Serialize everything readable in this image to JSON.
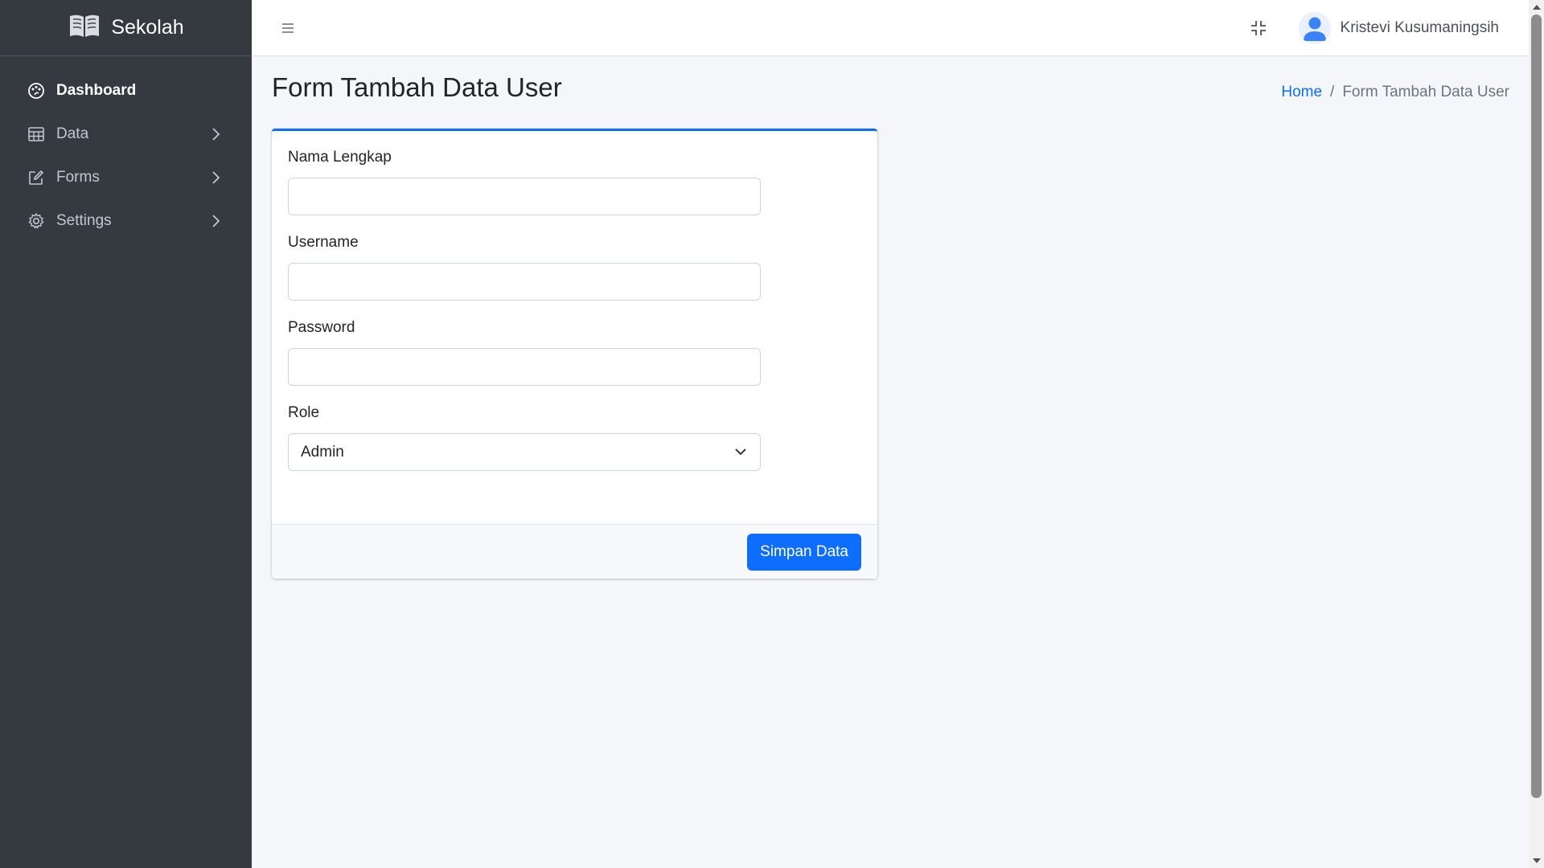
{
  "brand": {
    "name": "Sekolah",
    "icon": "book-open-icon"
  },
  "sidebar": {
    "items": [
      {
        "label": "Dashboard",
        "icon": "palette-icon",
        "active": true,
        "has_submenu": false
      },
      {
        "label": "Data",
        "icon": "table-icon",
        "active": false,
        "has_submenu": true
      },
      {
        "label": "Forms",
        "icon": "pencil-square-icon",
        "active": false,
        "has_submenu": true
      },
      {
        "label": "Settings",
        "icon": "gear-icon",
        "active": false,
        "has_submenu": true
      }
    ]
  },
  "topbar": {
    "menu_icon": "hamburger-icon",
    "fullscreen_icon": "fullscreen-exit-icon",
    "user": {
      "name": "Kristevi Kusumaningsih",
      "avatar_icon": "user-avatar-icon"
    }
  },
  "page": {
    "title": "Form Tambah Data User",
    "breadcrumb": {
      "home": "Home",
      "separator": "/",
      "current": "Form Tambah Data User"
    }
  },
  "form": {
    "fields": {
      "nama_lengkap": {
        "label": "Nama Lengkap",
        "value": "",
        "placeholder": ""
      },
      "username": {
        "label": "Username",
        "value": "",
        "placeholder": ""
      },
      "password": {
        "label": "Password",
        "value": "",
        "placeholder": ""
      },
      "role": {
        "label": "Role",
        "selected": "Admin"
      }
    },
    "submit_label": "Simpan Data"
  },
  "colors": {
    "sidebar_bg": "#343a40",
    "primary": "#0d6efd",
    "content_bg": "#f4f6f9"
  }
}
